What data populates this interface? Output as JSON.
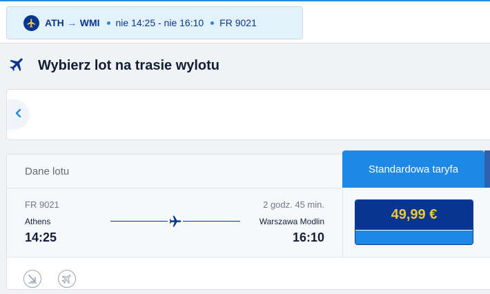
{
  "summary_chip": {
    "route_from": "ATH",
    "route_to": "WMI",
    "schedule": "nie 14:25 - nie 16:10",
    "flight_number": "FR 9021"
  },
  "page_title": "Wybierz lot na trasie wylotu",
  "flight_card": {
    "header_label": "Dane lotu",
    "fare_tab_label": "Standardowa taryfa",
    "flight_number": "FR 9021",
    "duration": "2 godz. 45 min.",
    "departure_city": "Athens",
    "arrival_city": "Warszawa Modlin",
    "departure_time": "14:25",
    "arrival_time": "16:10",
    "price": "49,99 €"
  },
  "icons": {
    "chip": "plane-badge-icon",
    "title": "plane-icon",
    "back": "chevron-left-icon",
    "route": "plane-icon",
    "footer": [
      "landing-icon",
      "plane-circle-icon"
    ]
  },
  "colors": {
    "brand_navy": "#073590",
    "accent_blue": "#1e88e5",
    "price_yellow": "#f1c933"
  }
}
